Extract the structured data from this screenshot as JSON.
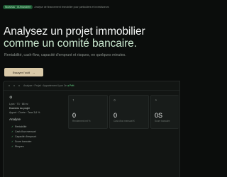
{
  "topbar": {
    "badge": "Nouveau · IA financière",
    "text": "Analyse de financement immobilier pour particuliers et investisseurs"
  },
  "hero": {
    "title_line1": "Analysez un projet immobilier",
    "title_line2": "comme un comité bancaire.",
    "subtitle": "Rentabilité, cash-flow, capacité d'emprunt et risques, en quelques minutes."
  },
  "cta": {
    "label": "Essayer l'outil",
    "arrow": "→"
  },
  "app": {
    "breadcrumb": "Analyse › Projet › Appartement Lyon 3e",
    "breadcrumb_status": "● Prêt",
    "sidebar": {
      "top_icon": "gear-icon",
      "line1": "Lyon · T3 · 68 m²",
      "line2": "Données du projet",
      "line3": "Apport · Durée · Taux 3,6 %",
      "section": "Analyse",
      "items": [
        "Rentabilité",
        "Cash-flow mensuel",
        "Capacité d'emprunt",
        "Score bancaire",
        "Risques"
      ]
    },
    "cards": [
      {
        "icon": "up-arrow-icon",
        "value": "0",
        "label": "Rendement net %"
      },
      {
        "icon": "circle-icon",
        "value": "0",
        "label": "Cash-flow mensuel €"
      },
      {
        "icon": "gauge-icon",
        "value": "0S",
        "label": "Score bancaire"
      }
    ]
  }
}
